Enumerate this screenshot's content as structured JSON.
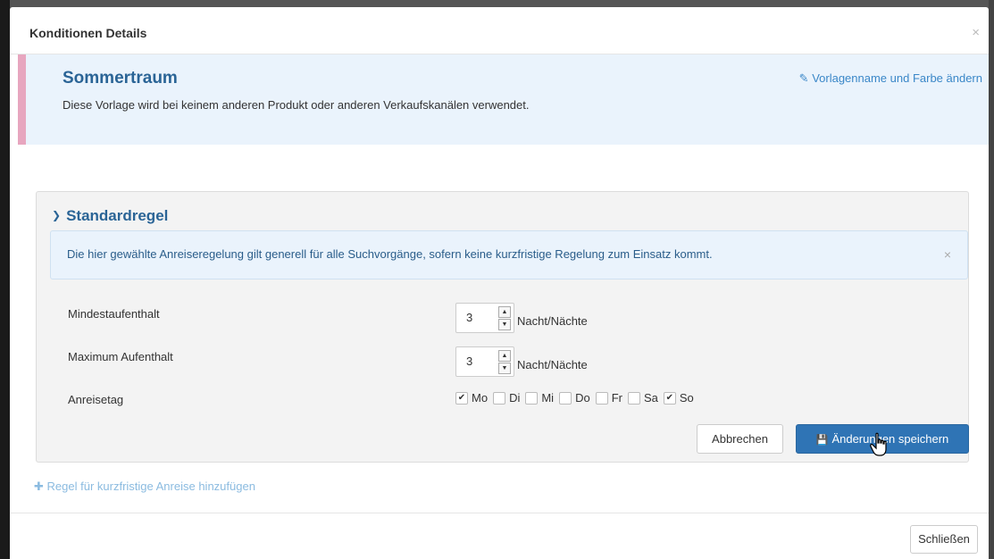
{
  "modal": {
    "title": "Konditionen Details",
    "close_x": "×"
  },
  "template": {
    "name": "Sommertraum",
    "description": "Diese Vorlage wird bei keinem anderen Produkt oder anderen Verkaufskanälen verwendet.",
    "edit_link": "Vorlagenname und Farbe ändern",
    "accent_color": "#e7a6bf"
  },
  "standard_rule": {
    "title": "Standardregel",
    "info_text": "Die hier gewählte Anreiseregelung gilt generell für alle Suchvorgänge, sofern keine kurzfristige Regelung zum Einsatz kommt.",
    "info_close": "×",
    "min_stay": {
      "label": "Mindestaufenthalt",
      "value": "3",
      "unit": "Nacht/Nächte"
    },
    "max_stay": {
      "label": "Maximum Aufenthalt",
      "value": "3",
      "unit": "Nacht/Nächte"
    },
    "arrival_day": {
      "label": "Anreisetag",
      "days": [
        {
          "label": "Mo",
          "checked": true
        },
        {
          "label": "Di",
          "checked": false
        },
        {
          "label": "Mi",
          "checked": false
        },
        {
          "label": "Do",
          "checked": false
        },
        {
          "label": "Fr",
          "checked": false
        },
        {
          "label": "Sa",
          "checked": false
        },
        {
          "label": "So",
          "checked": true
        }
      ]
    },
    "cancel_label": "Abbrechen",
    "save_label": "Änderungen speichern"
  },
  "add_rule_label": "Regel für kurzfristige Anreise hinzufügen",
  "footer": {
    "close_label": "Schließen"
  },
  "colors": {
    "primary": "#2f74b5",
    "title_blue": "#2a6496",
    "info_bg": "#eaf3fc"
  }
}
